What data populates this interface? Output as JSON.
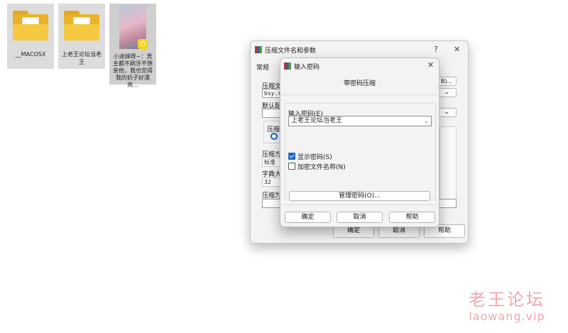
{
  "desktop": {
    "files": [
      {
        "name": "__MACOSX",
        "type": "folder"
      },
      {
        "name": "上老王论坛当老王",
        "type": "folder"
      },
      {
        "name": "小迷妹呀~：男主都不刷牙不想亲他，我也觉得我的奶子好漂亮...",
        "type": "image"
      }
    ]
  },
  "back_dialog": {
    "title": "压缩文件名和参数",
    "help_char": "?",
    "close_char": "✕",
    "tab_general": "常规",
    "label_archive_name": "压缩文",
    "archive_name_value": "bsy.r",
    "browse_label": "B)...",
    "label_profile": "默认配",
    "label_format": "压缩",
    "label_method": "压缩方",
    "method_value": "标准",
    "label_dict": "字典大",
    "dict_value": "32",
    "label_split": "压缩为",
    "ok_label": "确定",
    "cancel_label": "取消",
    "help_label": "帮助"
  },
  "password_dialog": {
    "title": "输入密码",
    "close_char": "✕",
    "heading": "带密码压缩",
    "password_label": "输入密码(E)",
    "password_value": "上老王论坛当老王",
    "show_password_label": "显示密码(S)",
    "show_password_checked": true,
    "encrypt_names_label": "加密文件名称(N)",
    "encrypt_names_checked": false,
    "manage_label": "管理密码(O)...",
    "ok_label": "确定",
    "cancel_label": "取消",
    "help_label": "帮助"
  },
  "watermark": {
    "cn": "老王论坛",
    "url": "laowang.vip"
  }
}
